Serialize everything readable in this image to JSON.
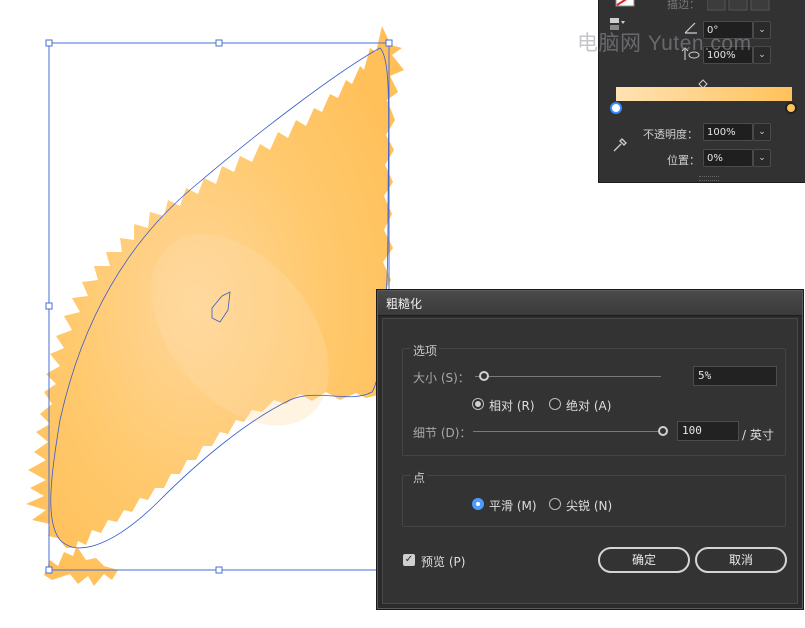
{
  "watermark": "电脑网 Yuten.com",
  "gradient_panel": {
    "stroke_label": "描边：",
    "angle_value": "0°",
    "aspect_value": "100%",
    "opacity_label": "不透明度：",
    "opacity_value": "100%",
    "location_label": "位置：",
    "location_value": "0%",
    "gradient_start_color": "#ffe2b4",
    "gradient_end_color": "#ffc25a"
  },
  "dialog": {
    "title": "粗糙化",
    "options_group": "选项",
    "size_label": "大小 (S)：",
    "size_value": "5%",
    "relative_label": "相对 (R)",
    "absolute_label": "绝对 (A)",
    "detail_label": "细节 (D)：",
    "detail_value": "100",
    "detail_unit": "/ 英寸",
    "points_group": "点",
    "smooth_label": "平滑 (M)",
    "corner_label": "尖锐 (N)",
    "preview_label": "预览 (P)",
    "ok_label": "确定",
    "cancel_label": "取消",
    "size_percent": 0.05,
    "detail_fraction": 1.0
  },
  "colors": {
    "shape_fill": "#ffc35e",
    "selection_blue": "#4a6fd6",
    "accent_blue": "#4a9dff"
  }
}
